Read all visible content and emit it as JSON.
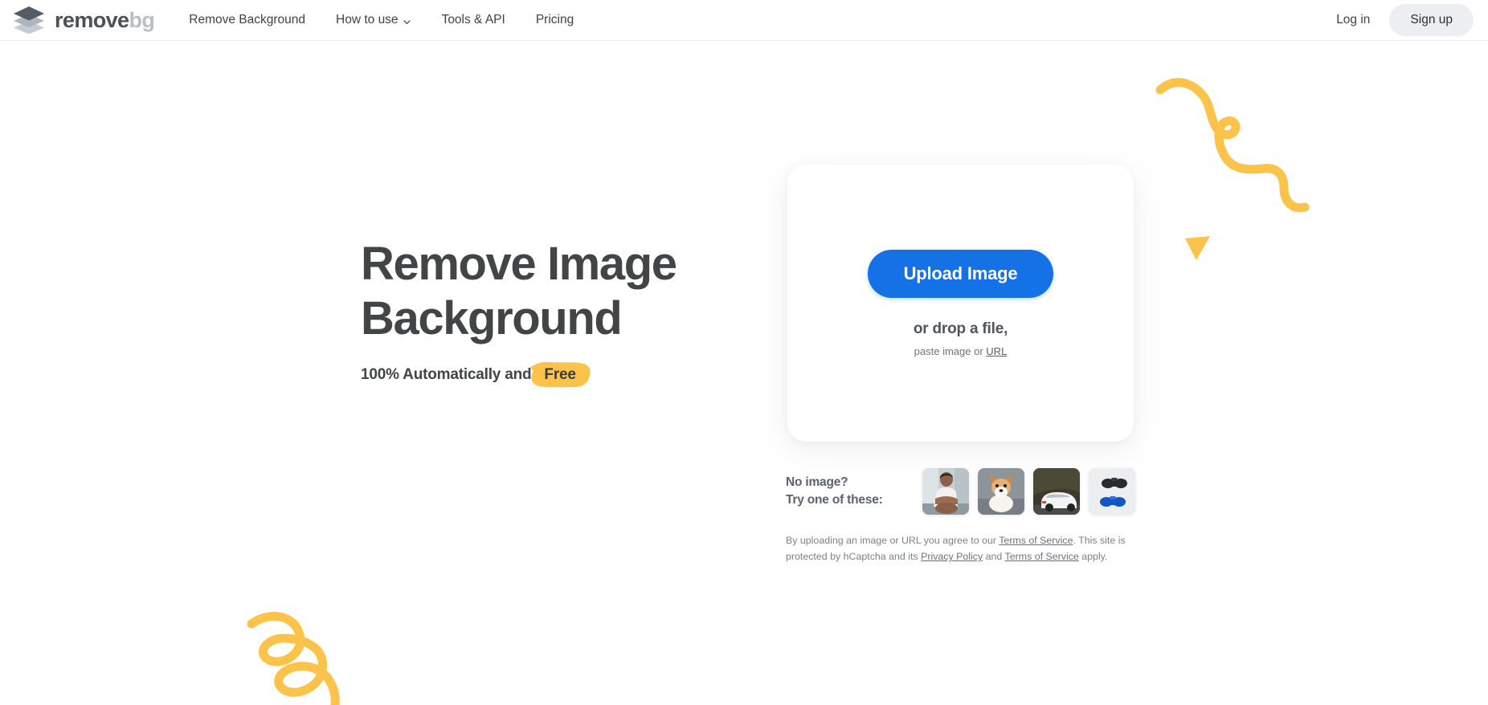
{
  "header": {
    "logo": {
      "name_dark": "remove",
      "name_grey": "bg",
      "icon": "stacked-diamond-logo"
    },
    "nav": [
      {
        "label": "Remove Background",
        "has_chevron": false
      },
      {
        "label": "How to use",
        "has_chevron": true
      },
      {
        "label": "Tools & API",
        "has_chevron": false
      },
      {
        "label": "Pricing",
        "has_chevron": false
      }
    ],
    "login_label": "Log in",
    "signup_label": "Sign up"
  },
  "hero": {
    "title_line1": "Remove Image",
    "title_line2": "Background",
    "subtitle_prefix": "100% Automatically and",
    "subtitle_highlight": "Free"
  },
  "upload": {
    "button_label": "Upload Image",
    "drop_text": "or drop a file,",
    "paste_prefix": "paste image or",
    "paste_link": "URL"
  },
  "samples": {
    "label_line1": "No image?",
    "label_line2": "Try one of these:",
    "thumbnails": [
      {
        "name": "sample-person",
        "alt": "man sitting in white t-shirt"
      },
      {
        "name": "sample-dog",
        "alt": "corgi dog on pavement"
      },
      {
        "name": "sample-car",
        "alt": "white hatchback car"
      },
      {
        "name": "sample-controllers",
        "alt": "black and blue game controllers"
      }
    ]
  },
  "legal": {
    "part1": "By uploading an image or URL you agree to our ",
    "link1": "Terms of Service",
    "part2": ". This site is protected by hCaptcha and its ",
    "link2": "Privacy Policy",
    "part3": " and ",
    "link3": "Terms of Service",
    "part4": " apply."
  },
  "colors": {
    "accent_blue": "#1571e6",
    "accent_yellow": "#fbc34a",
    "logo_dark": "#4a5158",
    "logo_grey": "#b9bfc6",
    "heading": "#434445",
    "signup_bg": "#eceef1"
  }
}
